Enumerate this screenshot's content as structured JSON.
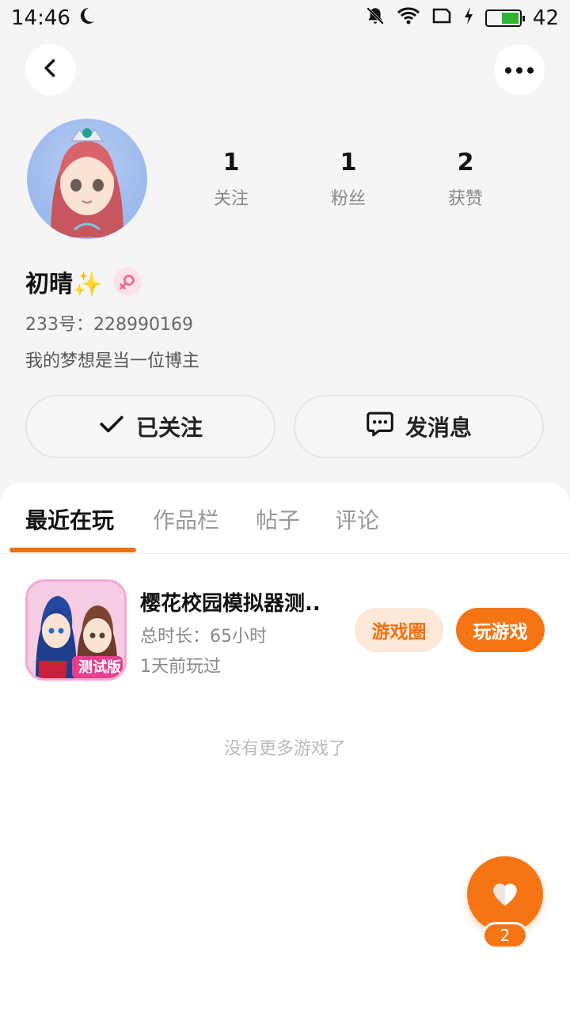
{
  "status_bar": {
    "time": "14:46",
    "battery_level": "42",
    "battery_fraction": 0.42
  },
  "header": {
    "back_icon": "chevron-left-icon",
    "more_icon": "more-dots-icon"
  },
  "profile": {
    "stats": [
      {
        "value": "1",
        "label": "关注"
      },
      {
        "value": "1",
        "label": "粉丝"
      },
      {
        "value": "2",
        "label": "获赞"
      }
    ],
    "name": "初晴✨",
    "gender_icon": "female-icon",
    "id_line": "233号：228990169",
    "bio": "我的梦想是当一位博主"
  },
  "actions": {
    "follow_label": "已关注",
    "message_label": "发消息"
  },
  "tabs": [
    {
      "label": "最近在玩",
      "active": true
    },
    {
      "label": "作品栏",
      "active": false
    },
    {
      "label": "帖子",
      "active": false
    },
    {
      "label": "评论",
      "active": false
    }
  ],
  "games": [
    {
      "title": "樱花校园模拟器测..",
      "duration": "总时长：65小时",
      "last_played": "1天前玩过",
      "icon_badge": "测试版",
      "circle_label": "游戏圈",
      "play_label": "玩游戏"
    }
  ],
  "empty_hint": "没有更多游戏了",
  "fab": {
    "icon": "heart-icon",
    "count": "2"
  },
  "colors": {
    "accent": "#f57514",
    "accent_light": "#fde8d7",
    "background": "#f5f5f5"
  }
}
